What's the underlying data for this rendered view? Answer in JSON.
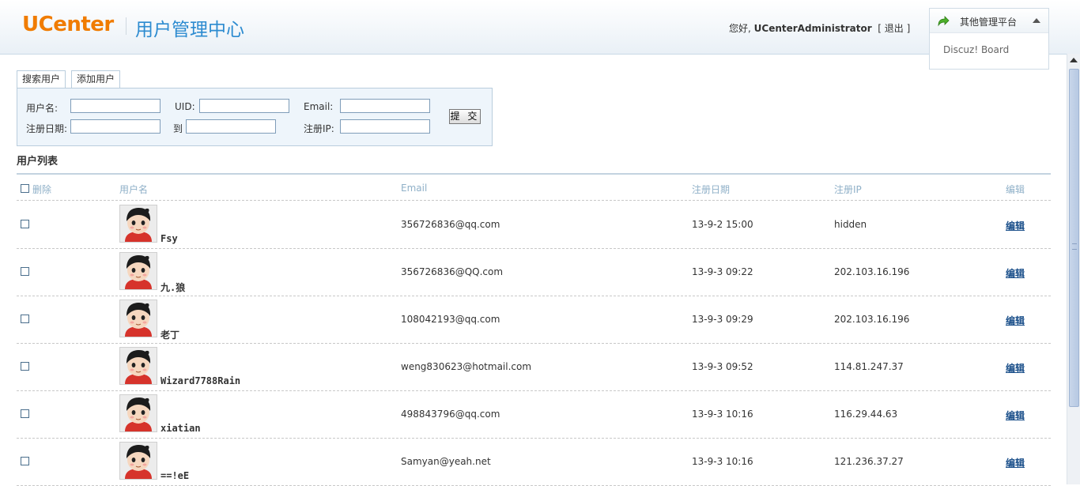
{
  "header": {
    "logo": "UCenter",
    "subtitle": "用户管理中心",
    "greeting": "您好,",
    "username": "UCenterAdministrator",
    "logout": "[ 退出 ]",
    "platform_label": "其他管理平台",
    "platform_items": [
      "Discuz! Board"
    ]
  },
  "tabs": [
    "搜索用户",
    "添加用户"
  ],
  "search": {
    "username_label": "用户名:",
    "uid_label": "UID:",
    "email_label": "Email:",
    "regdate_label": "注册日期:",
    "to_label": "到",
    "regip_label": "注册IP:",
    "submit": "提 交"
  },
  "list_title": "用户列表",
  "columns": {
    "delete": "删除",
    "username": "用户名",
    "email": "Email",
    "regdate": "注册日期",
    "regip": "注册IP",
    "edit": "编辑"
  },
  "users": [
    {
      "username": "Fsy",
      "email": "356726836@qq.com",
      "regdate": "13-9-2 15:00",
      "regip": "hidden",
      "edit": "编辑"
    },
    {
      "username": "九.狼",
      "email": "356726836@QQ.com",
      "regdate": "13-9-3 09:22",
      "regip": "202.103.16.196",
      "edit": "编辑"
    },
    {
      "username": "老丁",
      "email": "108042193@qq.com",
      "regdate": "13-9-3 09:29",
      "regip": "202.103.16.196",
      "edit": "编辑"
    },
    {
      "username": "Wizard7788Rain",
      "email": "weng830623@hotmail.com",
      "regdate": "13-9-3 09:52",
      "regip": "114.81.247.37",
      "edit": "编辑"
    },
    {
      "username": "xiatian",
      "email": "498843796@qq.com",
      "regdate": "13-9-3 10:16",
      "regip": "116.29.44.63",
      "edit": "编辑"
    },
    {
      "username": "==!eE",
      "email": "Samyan@yeah.net",
      "regdate": "13-9-3 10:16",
      "regip": "121.236.37.27",
      "edit": "编辑"
    }
  ],
  "colors": {
    "logo": "#f07c00",
    "subtitle": "#2d8bd0",
    "header_muted": "#8fb0c8",
    "link": "#1a4f8a"
  }
}
